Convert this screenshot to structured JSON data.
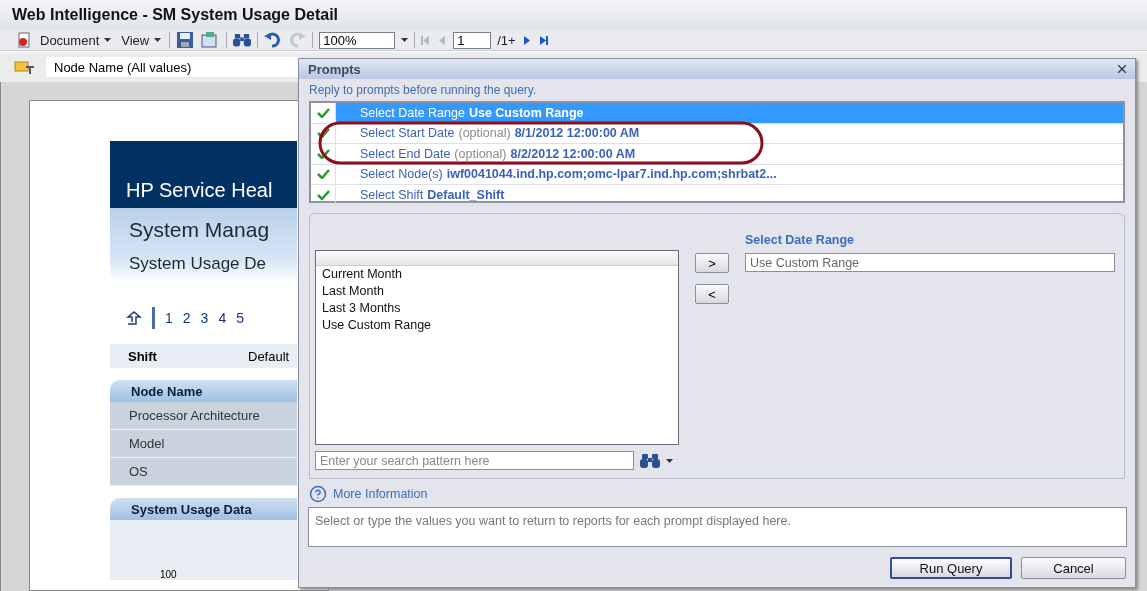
{
  "window": {
    "title": "Web Intelligence - SM System Usage Detail"
  },
  "toolbar": {
    "menus": [
      {
        "label": "Document"
      },
      {
        "label": "View"
      }
    ],
    "redo": {
      "disabled": true
    },
    "zoom": "100%",
    "first": {
      "disabled": true
    },
    "prev": {
      "disabled": true
    },
    "page": "1",
    "page_suffix": "/1+"
  },
  "filter": {
    "value": "Node Name (All values)"
  },
  "report": {
    "banner": "HP Service Heal",
    "title": "System Manag",
    "subtitle": "System Usage De",
    "pages": [
      "1",
      "2",
      "3",
      "4",
      "5"
    ],
    "shift": {
      "label": "Shift",
      "value": "Default"
    },
    "node_section": {
      "title": "Node Name",
      "rows": [
        "Processor Architecture",
        "Model",
        "OS"
      ]
    },
    "usage_section": {
      "title": "System Usage Data",
      "axis_label": "100"
    }
  },
  "dialog": {
    "title": "Prompts",
    "intro": "Reply to prompts before running the query.",
    "prompts": [
      {
        "label": "Select Date Range",
        "value": "Use Custom Range",
        "answered": true,
        "selected": true
      },
      {
        "label": "Select Start Date",
        "note": "(optional)",
        "value": "8/1/2012 12:00:00 AM",
        "answered": true,
        "selected": false
      },
      {
        "label": "Select End Date",
        "note": "(optional)",
        "value": "8/2/2012 12:00:00 AM",
        "answered": true,
        "selected": false
      },
      {
        "label": "Select Node(s)",
        "value": "iwf0041044.ind.hp.com;omc-lpar7.ind.hp.com;shrbat2...",
        "answered": true,
        "selected": false
      },
      {
        "label": "Select Shift",
        "value": "Default_Shift",
        "answered": true,
        "selected": false
      }
    ],
    "highlight_oval": true,
    "lov": {
      "items": [
        "Current Month",
        "Last Month",
        "Last 3 Months",
        "Use Custom Range"
      ],
      "search_placeholder": "Enter your search pattern here"
    },
    "add_button": ">",
    "remove_button": "<",
    "selection": {
      "label": "Select Date Range",
      "value": "Use Custom Range"
    },
    "more_info": "More Information",
    "description": "Select or type the values you want to return to reports for each prompt displayed here.",
    "buttons": [
      {
        "label": "Run Query",
        "default": true
      },
      {
        "label": "Cancel",
        "default": false
      }
    ]
  }
}
